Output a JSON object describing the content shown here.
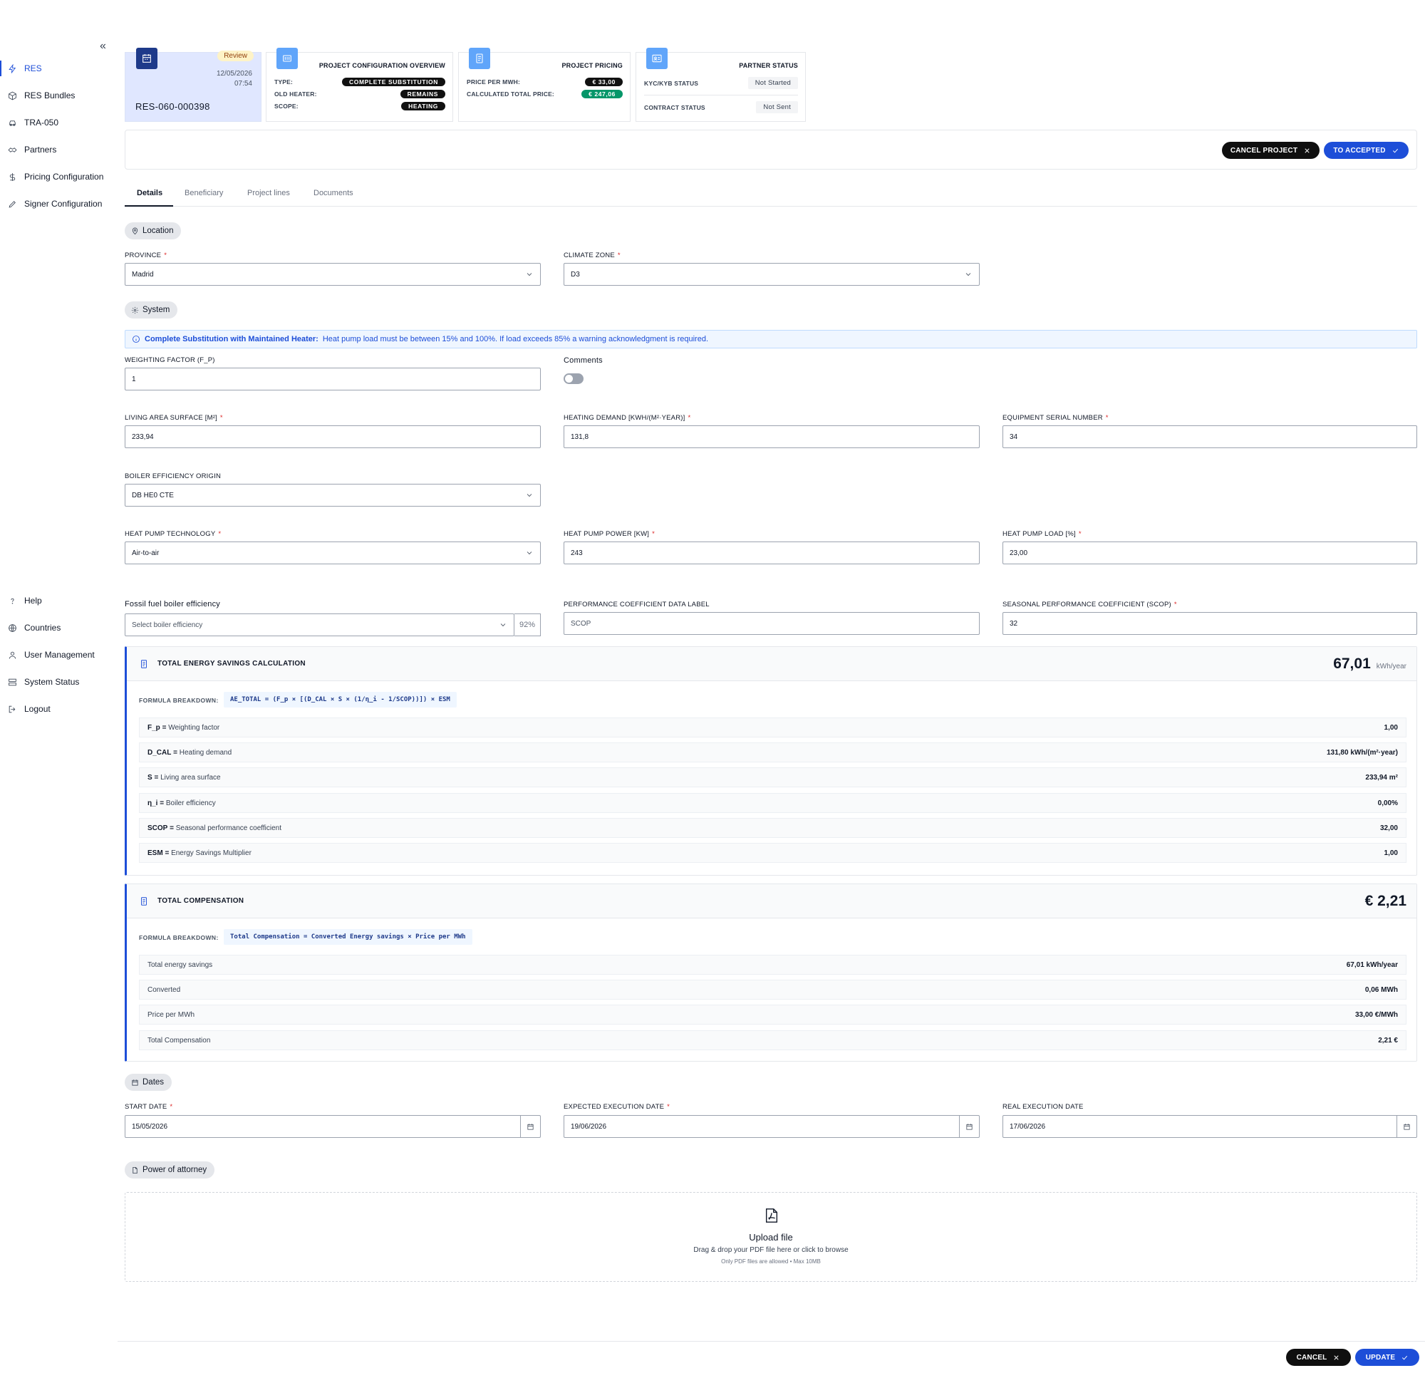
{
  "sidebar": {
    "top_items": [
      {
        "label": "RES",
        "icon": "bolt-icon",
        "active": true
      },
      {
        "label": "RES Bundles",
        "icon": "package-icon"
      },
      {
        "label": "TRA-050",
        "icon": "car-icon"
      },
      {
        "label": "Partners",
        "icon": "handshake-icon"
      },
      {
        "label": "Pricing Configuration",
        "icon": "dollar-icon"
      },
      {
        "label": "Signer Configuration",
        "icon": "pen-icon"
      }
    ],
    "bottom_items": [
      {
        "label": "Help",
        "icon": "question-icon"
      },
      {
        "label": "Countries",
        "icon": "globe-icon"
      },
      {
        "label": "User Management",
        "icon": "user-icon"
      },
      {
        "label": "System Status",
        "icon": "server-icon"
      },
      {
        "label": "Logout",
        "icon": "logout-icon"
      }
    ],
    "collapse_glyph": "«"
  },
  "project_card": {
    "status": "Review",
    "date": "12/05/2026",
    "time": "07:54",
    "code": "RES-060-000398"
  },
  "config_card": {
    "title": "PROJECT CONFIGURATION OVERVIEW",
    "rows": [
      {
        "label": "TYPE:",
        "value": "COMPLETE SUBSTITUTION"
      },
      {
        "label": "OLD HEATER:",
        "value": "REMAINS"
      },
      {
        "label": "SCOPE:",
        "value": "HEATING"
      }
    ]
  },
  "pricing_card": {
    "title": "PROJECT PRICING",
    "rows": [
      {
        "label": "PRICE PER MWH:",
        "value": "€ 33,00"
      },
      {
        "label": "CALCULATED TOTAL PRICE:",
        "value": "€ 247,06"
      }
    ]
  },
  "partner_card": {
    "title": "PARTNER STATUS",
    "rows": [
      {
        "label": "KYC/KYB STATUS",
        "value": "Not Started"
      },
      {
        "label": "CONTRACT STATUS",
        "value": "Not Sent"
      }
    ]
  },
  "actions": {
    "cancel_project": "CANCEL PROJECT",
    "to_accepted": "TO ACCEPTED"
  },
  "tabs": [
    "Details",
    "Beneficiary",
    "Project lines",
    "Documents"
  ],
  "sections": {
    "location": "Location",
    "system": "System",
    "dates": "Dates",
    "poa": "Power of attorney"
  },
  "fields": {
    "province": {
      "label": "PROVINCE",
      "value": "Madrid"
    },
    "climate_zone": {
      "label": "CLIMATE ZONE",
      "value": "D3"
    },
    "weighting_factor": {
      "label": "WEIGHTING FACTOR (F_P)",
      "value": "1"
    },
    "comments": {
      "label": "Comments"
    },
    "living_area": {
      "label": "LIVING AREA SURFACE [M²]",
      "value": "233,94"
    },
    "heating_demand": {
      "label": "HEATING DEMAND [KWH/(M²·YEAR)]",
      "value": "131,8"
    },
    "serial_number": {
      "label": "EQUIPMENT SERIAL NUMBER",
      "value": "34"
    },
    "boiler_origin": {
      "label": "BOILER EFFICIENCY ORIGIN",
      "value": "DB HE0 CTE"
    },
    "hp_technology": {
      "label": "HEAT PUMP TECHNOLOGY",
      "value": "Air-to-air"
    },
    "hp_power": {
      "label": "HEAT PUMP POWER [KW]",
      "value": "243"
    },
    "hp_load": {
      "label": "HEAT PUMP LOAD [%]",
      "value": "23,00"
    },
    "fossil_eff": {
      "label": "Fossil fuel boiler efficiency",
      "placeholder": "Select boiler efficiency",
      "suffix": "92%"
    },
    "perf_label": {
      "label": "PERFORMANCE COEFFICIENT DATA LABEL",
      "value": "SCOP"
    },
    "scop": {
      "label": "SEASONAL PERFORMANCE COEFFICIENT (SCOP)",
      "value": "32"
    },
    "start_date": {
      "label": "START DATE",
      "value": "15/05/2026"
    },
    "expected_date": {
      "label": "EXPECTED EXECUTION DATE",
      "value": "19/06/2026"
    },
    "real_date": {
      "label": "REAL EXECUTION DATE",
      "value": "17/06/2026"
    }
  },
  "info": {
    "bold": "Complete Substitution with Maintained Heater:",
    "text": "Heat pump load must be between 15% and 100%. If load exceeds 85% a warning acknowledgment is required."
  },
  "energy_panel": {
    "title": "TOTAL ENERGY SAVINGS CALCULATION",
    "value": "67,01",
    "unit": "kWh/year",
    "formula_label": "FORMULA BREAKDOWN:",
    "formula": "AE_TOTAL = (F_p × [(D_CAL × S × (1/η_i - 1/SCOP))]) × ESM",
    "rows": [
      {
        "key": "F_p",
        "desc": "Weighting factor",
        "value": "1,00"
      },
      {
        "key": "D_CAL",
        "desc": "Heating demand",
        "value": "131,80 kWh/(m²·year)"
      },
      {
        "key": "S",
        "desc": "Living area surface",
        "value": "233,94 m²"
      },
      {
        "key": "η_i",
        "desc": "Boiler efficiency",
        "value": "0,00%"
      },
      {
        "key": "SCOP",
        "desc": "Seasonal performance coefficient",
        "value": "32,00"
      },
      {
        "key": "ESM",
        "desc": "Energy Savings Multiplier",
        "value": "1,00"
      }
    ]
  },
  "comp_panel": {
    "title": "TOTAL COMPENSATION",
    "value": "€ 2,21",
    "formula_label": "FORMULA BREAKDOWN:",
    "formula": "Total Compensation = Converted Energy savings × Price per MWh",
    "rows": [
      {
        "desc": "Total energy savings",
        "value": "67,01 kWh/year"
      },
      {
        "desc": "Converted",
        "value": "0,06 MWh"
      },
      {
        "desc": "Price per MWh",
        "value": "33,00 €/MWh"
      },
      {
        "desc": "Total Compensation",
        "value": "2,21 €"
      }
    ]
  },
  "upload": {
    "title": "Upload file",
    "subtitle": "Drag & drop your PDF file here or click to browse",
    "hint": "Only PDF files are allowed • Max 10MB"
  },
  "footer": {
    "cancel": "CANCEL",
    "update": "UPDATE"
  },
  "colors": {
    "primary": "#1d4ed8",
    "dark_button": "#0f0f0f",
    "review_badge": "#fef3c7",
    "success_pill": "#059669",
    "card_highlight": "#e0e7ff"
  }
}
